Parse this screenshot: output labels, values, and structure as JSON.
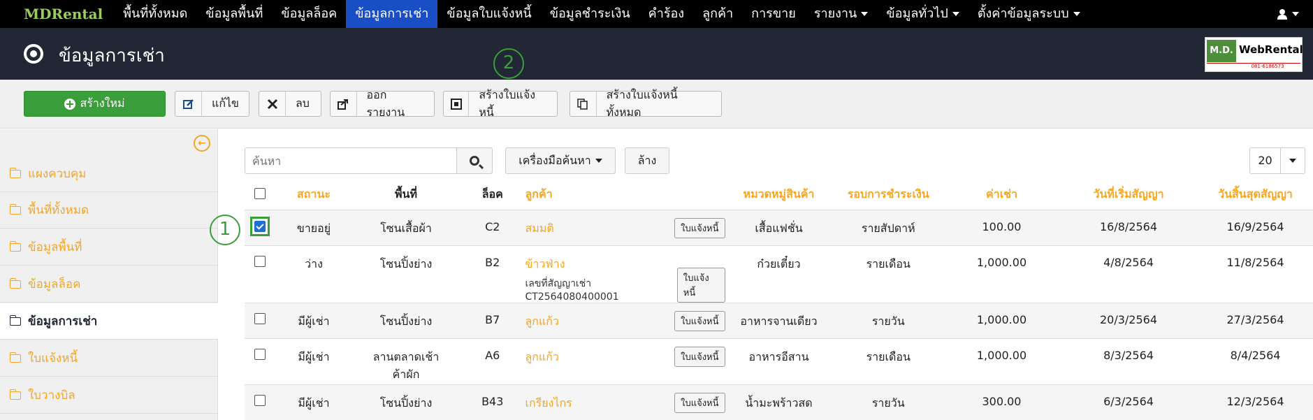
{
  "brand": "MDRental",
  "nav": [
    {
      "label": "พื้นที่ทั้งหมด",
      "active": false,
      "dropdown": false
    },
    {
      "label": "ข้อมูลพื้นที่",
      "active": false,
      "dropdown": false
    },
    {
      "label": "ข้อมูลล็อค",
      "active": false,
      "dropdown": false
    },
    {
      "label": "ข้อมูลการเช่า",
      "active": true,
      "dropdown": false
    },
    {
      "label": "ข้อมูลใบแจ้งหนี้",
      "active": false,
      "dropdown": false
    },
    {
      "label": "ข้อมูลชำระเงิน",
      "active": false,
      "dropdown": false
    },
    {
      "label": "คำร้อง",
      "active": false,
      "dropdown": false
    },
    {
      "label": "ลูกค้า",
      "active": false,
      "dropdown": false
    },
    {
      "label": "การขาย",
      "active": false,
      "dropdown": false
    },
    {
      "label": "รายงาน",
      "active": false,
      "dropdown": true
    },
    {
      "label": "ข้อมูลทั่วไป",
      "active": false,
      "dropdown": true
    },
    {
      "label": "ตั้งค่าข้อมูลระบบ",
      "active": false,
      "dropdown": true
    }
  ],
  "header": {
    "title": "ข้อมูลการเช่า"
  },
  "logo": {
    "md": "M.D.",
    "web": "WebRental",
    "sub": "081-6186573"
  },
  "toolbar": {
    "create": "สร้างใหม่",
    "edit": "แก้ไข",
    "delete": "ลบ",
    "report": "ออกรายงาน",
    "create_invoice": "สร้างใบแจ้งหนี้",
    "create_all_invoices": "สร้างใบแจ้งหนี้ทั้งหมด"
  },
  "sidebar": {
    "items": [
      {
        "label": "แผงควบคุม",
        "active": false
      },
      {
        "label": "พื้นที่ทั้งหมด",
        "active": false
      },
      {
        "label": "ข้อมูลพื้นที่",
        "active": false
      },
      {
        "label": "ข้อมูลล็อค",
        "active": false
      },
      {
        "label": "ข้อมูลการเช่า",
        "active": true
      },
      {
        "label": "ใบแจ้งหนี้",
        "active": false
      },
      {
        "label": "ใบวางบิล",
        "active": false
      }
    ]
  },
  "search": {
    "placeholder": "ค้นหา",
    "tools": "เครื่องมือค้นหา",
    "clear": "ล้าง",
    "page_size": "20"
  },
  "table": {
    "headers": {
      "status": "สถานะ",
      "area": "พื้นที่",
      "lock": "ล็อค",
      "customer": "ลูกค้า",
      "category": "หมวดหมู่สินค้า",
      "cycle": "รอบการชำระเงิน",
      "rent": "ค่าเช่า",
      "start": "วันที่เริ่มสัญญา",
      "end": "วันสิ้นสุดสัญญา"
    },
    "invoice_button": "ใบแจ้งหนี้",
    "rows": [
      {
        "checked": true,
        "status": "ขายอยู่",
        "area": "โซนเสื้อผ้า",
        "area2": "",
        "lock": "C2",
        "customer": "สมมติ",
        "contract": "",
        "category": "เสื้อแฟชั่น",
        "cycle": "รายสัปดาห์",
        "rent": "100.00",
        "start": "16/8/2564",
        "end": "16/9/2564"
      },
      {
        "checked": false,
        "status": "ว่าง",
        "area": "โซนปิ้งย่าง",
        "area2": "",
        "lock": "B2",
        "customer": "ข้าวฟ่าง",
        "contract": "เลขที่สัญญาเช่า CT2564080400001",
        "category": "ก๋วยเตี๋ยว",
        "cycle": "รายเดือน",
        "rent": "1,000.00",
        "start": "4/8/2564",
        "end": "11/8/2564"
      },
      {
        "checked": false,
        "status": "มีผู้เช่า",
        "area": "โซนปิ้งย่าง",
        "area2": "",
        "lock": "B7",
        "customer": "ลูกแก้ว",
        "contract": "",
        "category": "อาหารจานเดียว",
        "cycle": "รายวัน",
        "rent": "1,000.00",
        "start": "20/3/2564",
        "end": "27/3/2564"
      },
      {
        "checked": false,
        "status": "มีผู้เช่า",
        "area": "ลานตลาดเช้า",
        "area2": "ค้าผัก",
        "lock": "A6",
        "customer": "ลูกแก้ว",
        "contract": "",
        "category": "อาหารอีสาน",
        "cycle": "รายเดือน",
        "rent": "1,000.00",
        "start": "8/3/2564",
        "end": "8/4/2564"
      },
      {
        "checked": false,
        "status": "มีผู้เช่า",
        "area": "โซนปิ้งย่าง",
        "area2": "",
        "lock": "B43",
        "customer": "เกรียงไกร",
        "contract": "",
        "category": "น้ำมะพร้าวสด",
        "cycle": "รายวัน",
        "rent": "300.00",
        "start": "6/3/2564",
        "end": "12/3/2564"
      }
    ]
  },
  "markers": {
    "one": "1",
    "two": "2"
  }
}
